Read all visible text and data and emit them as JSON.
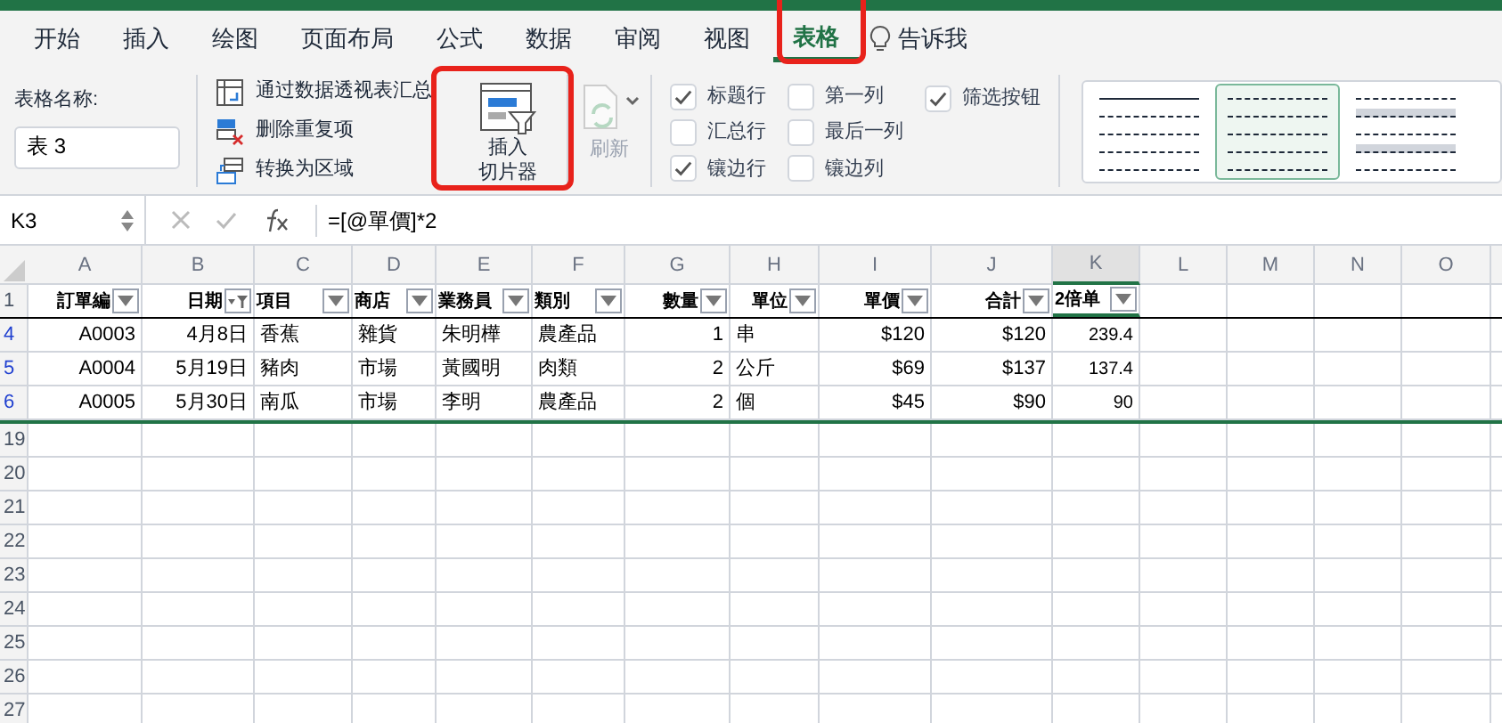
{
  "tabs": [
    {
      "label": "开始",
      "selected": false
    },
    {
      "label": "插入",
      "selected": false
    },
    {
      "label": "绘图",
      "selected": false
    },
    {
      "label": "页面布局",
      "selected": false
    },
    {
      "label": "公式",
      "selected": false
    },
    {
      "label": "数据",
      "selected": false
    },
    {
      "label": "审阅",
      "selected": false
    },
    {
      "label": "视图",
      "selected": false
    },
    {
      "label": "表格",
      "selected": true
    }
  ],
  "tell_me": "告诉我",
  "ribbon": {
    "table_name_label": "表格名称:",
    "table_name": "表 3",
    "commands": [
      {
        "label": "通过数据透视表汇总",
        "kind": "pivot"
      },
      {
        "label": "删除重复项",
        "kind": "dedupe"
      },
      {
        "label": "转换为区域",
        "kind": "convert"
      }
    ],
    "slicer_button": [
      "插入",
      "切片器"
    ],
    "refresh_button": {
      "label": "刷新",
      "disabled": true
    },
    "options": [
      [
        {
          "label": "标题行",
          "checked": true
        },
        {
          "label": "汇总行",
          "checked": false
        },
        {
          "label": "镶边行",
          "checked": true
        }
      ],
      [
        {
          "label": "第一列",
          "checked": false
        },
        {
          "label": "最后一列",
          "checked": false
        },
        {
          "label": "镶边列",
          "checked": false
        }
      ],
      [
        {
          "label": "筛选按钮",
          "checked": true
        }
      ]
    ],
    "styles": [
      {
        "kind": "lines",
        "selected": false
      },
      {
        "kind": "plain",
        "selected": true
      },
      {
        "kind": "banded",
        "selected": false
      }
    ]
  },
  "formula_bar": {
    "name_box": "K3",
    "formula": "=[@單價]*2"
  },
  "sheet": {
    "columns": [
      {
        "letter": "A",
        "selected": false
      },
      {
        "letter": "B",
        "selected": false
      },
      {
        "letter": "C",
        "selected": false
      },
      {
        "letter": "D",
        "selected": false
      },
      {
        "letter": "E",
        "selected": false
      },
      {
        "letter": "F",
        "selected": false
      },
      {
        "letter": "G",
        "selected": false
      },
      {
        "letter": "H",
        "selected": false
      },
      {
        "letter": "I",
        "selected": false
      },
      {
        "letter": "J",
        "selected": false
      },
      {
        "letter": "K",
        "selected": true
      },
      {
        "letter": "L",
        "selected": false
      },
      {
        "letter": "M",
        "selected": false
      },
      {
        "letter": "N",
        "selected": false
      },
      {
        "letter": "O",
        "selected": false
      }
    ],
    "header": {
      "number": "1",
      "cells": [
        {
          "text": "訂單編",
          "kind": "code",
          "filtered": false
        },
        {
          "text": "日期",
          "kind": "date",
          "filtered": true
        },
        {
          "text": "項目",
          "kind": "text",
          "filtered": false
        },
        {
          "text": "商店",
          "kind": "text",
          "filtered": false
        },
        {
          "text": "業務員",
          "kind": "text",
          "filtered": false
        },
        {
          "text": "類別",
          "kind": "text",
          "filtered": false
        },
        {
          "text": "數量",
          "kind": "number",
          "filtered": false
        },
        {
          "text": "單位",
          "kind": "unit",
          "filtered": false
        },
        {
          "text": "單價",
          "kind": "currency",
          "filtered": false
        },
        {
          "text": "合計",
          "kind": "currency",
          "filtered": false
        },
        {
          "text": "2倍单",
          "kind": "formula",
          "filtered": false
        }
      ]
    },
    "rows": [
      {
        "number": "4",
        "filtered": true,
        "cells": [
          "A0003",
          "4月8日",
          "香蕉",
          "雜貨",
          "朱明樺",
          "農產品",
          "1",
          "串",
          "$120",
          "$120",
          "239.4"
        ]
      },
      {
        "number": "5",
        "filtered": true,
        "cells": [
          "A0004",
          "5月19日",
          "豬肉",
          "市場",
          "黃國明",
          "肉類",
          "2",
          "公斤",
          "$69",
          "$137",
          "137.4"
        ]
      },
      {
        "number": "6",
        "filtered": true,
        "cells": [
          "A0005",
          "5月30日",
          "南瓜",
          "市場",
          "李明",
          "農產品",
          "2",
          "個",
          "$45",
          "$90",
          "90"
        ]
      }
    ],
    "empty_rows": [
      "19",
      "20",
      "21",
      "22",
      "23",
      "24",
      "25",
      "26",
      "27"
    ]
  }
}
